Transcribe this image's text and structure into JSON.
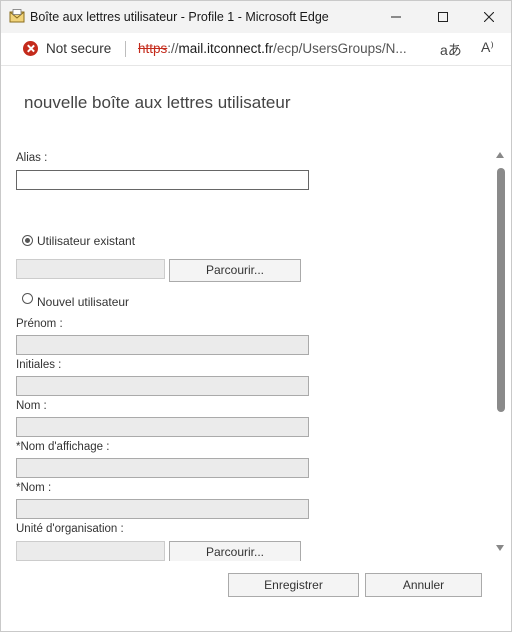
{
  "window": {
    "title": "Boîte aux lettres utilisateur - Profile 1 - Microsoft Edge",
    "icons": {
      "app": "mail-app-icon",
      "minimize": "minimize-icon",
      "maximize": "maximize-icon",
      "close": "close-icon"
    }
  },
  "addressbar": {
    "security_label": "Not secure",
    "url_protocol": "https",
    "url_separator": "://",
    "url_host": "mail.itconnect.fr",
    "url_path": "/ecp/UsersGroups/N...",
    "icons": {
      "security": "not-secure-icon",
      "translate": "translate-icon",
      "read_aloud": "read-aloud-icon"
    },
    "translate_glyph": "aあ",
    "read_glyph": "A⁾"
  },
  "form": {
    "title": "nouvelle boîte aux lettres utilisateur",
    "alias_label": "Alias :",
    "alias_value": "",
    "existing_user_label": "Utilisateur existant",
    "existing_user_selected": true,
    "browse_label": "Parcourir...",
    "new_user_label": "Nouvel utilisateur",
    "new_user_selected": false,
    "firstname_label": "Prénom :",
    "initials_label": "Initiales :",
    "lastname_label": "Nom :",
    "displayname_label": "*Nom d'affichage :",
    "name_label": "*Nom :",
    "ou_label": "Unité d'organisation :",
    "ou_browse_label": "Parcourir..."
  },
  "footer": {
    "save_label": "Enregistrer",
    "cancel_label": "Annuler"
  },
  "colors": {
    "insecure": "#c42b1c",
    "field_disabled": "#ebebeb",
    "scroll_thumb": "#8a8a8a"
  }
}
